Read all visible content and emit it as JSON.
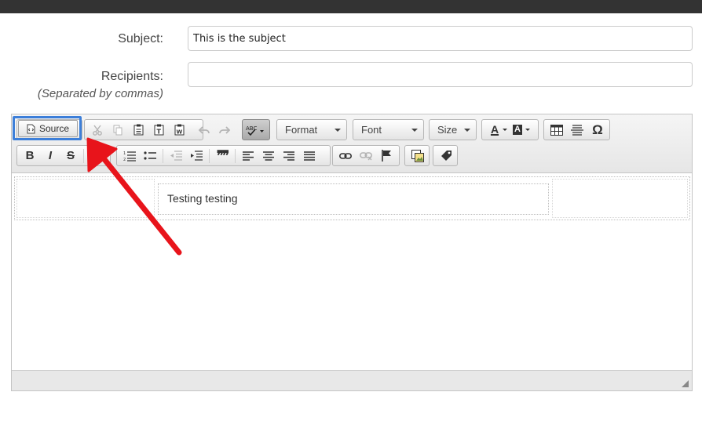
{
  "form": {
    "subject_label": "Subject:",
    "subject_value": "This is the subject",
    "recipients_label": "Recipients:",
    "recipients_hint": "(Separated by commas)",
    "recipients_value": ""
  },
  "toolbar": {
    "source_label": "Source",
    "format_label": "Format",
    "font_label": "Font",
    "size_label": "Size",
    "text_color_letter": "A",
    "bg_color_letter": "A",
    "special_char": "Ω",
    "bold": "B",
    "italic": "I",
    "strike": "S",
    "blockquote": "99",
    "spellcheck": "ABC"
  },
  "editor": {
    "cell_text": "Testing testing"
  },
  "colors": {
    "highlight": "#3d7fd9",
    "annotation_arrow": "#e8141b",
    "topbar": "#333333"
  }
}
